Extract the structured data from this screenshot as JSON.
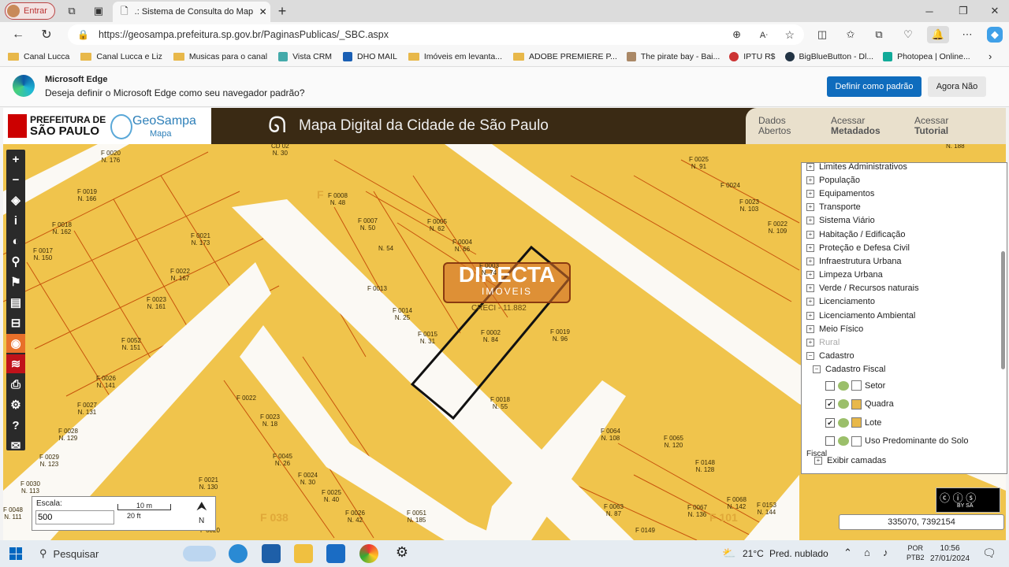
{
  "browser": {
    "profile_label": "Entrar",
    "tab_title": ".: Sistema de Consulta do Mapa D",
    "url": "https://geosampa.prefeitura.sp.gov.br/PaginasPublicas/_SBC.aspx",
    "bookmarks": [
      "Canal Lucca",
      "Canal Lucca e Liz",
      "Musicas para o canal",
      "Vista CRM",
      "DHO MAIL",
      "Imóveis em levanta...",
      "ADOBE PREMIERE P...",
      "The pirate bay - Bai...",
      "IPTU R$",
      "BigBlueButton - Dl...",
      "Photopea | Online..."
    ],
    "edge_prompt": {
      "title": "Microsoft Edge",
      "text": "Deseja definir o Microsoft Edge como seu navegador padrão?",
      "primary": "Definir como padrão",
      "secondary": "Agora Não"
    }
  },
  "site": {
    "prefeitura_line1": "PREFEITURA DE",
    "prefeitura_line2": "SÃO PAULO",
    "geosampa": "GeoSampa",
    "geosampa_sub": "Mapa",
    "title": "Mapa Digital da Cidade de São Paulo",
    "links": [
      [
        "Dados",
        "Abertos"
      ],
      [
        "Acessar",
        "Metadados"
      ],
      [
        "Acessar",
        "Tutorial"
      ]
    ]
  },
  "map": {
    "watermark": "DIRECTA",
    "watermark_sub": "IMOVEIS",
    "creci": "CRECI - 11.882",
    "labels": [
      [
        "F 0026",
        "N. 81"
      ],
      [
        "F 0020",
        "N. 176"
      ],
      [
        "CD 02",
        "N. 30"
      ],
      [
        "F 0019",
        "N. 166"
      ],
      [
        "F 0008",
        "N. 48"
      ],
      [
        "F 0018",
        "N. 162"
      ],
      [
        "F 0021",
        "N. 173"
      ],
      [
        "F 0007",
        "N. 50"
      ],
      [
        "F 0005",
        "N. 62"
      ],
      [
        "F 0004",
        "N. 66"
      ],
      [
        "F 0017",
        "N. 150"
      ],
      [
        "N. 54",
        ""
      ],
      [
        "F 0003",
        "N. 74"
      ],
      [
        "F 0022",
        "N. 167"
      ],
      [
        "F 0013",
        ""
      ],
      [
        "F 0023",
        "N. 161"
      ],
      [
        "F 0014",
        "N. 25"
      ],
      [
        "F 0015",
        "N. 31"
      ],
      [
        "F 0002",
        "N. 84"
      ],
      [
        "F 0019",
        "N. 96"
      ],
      [
        "F 0052",
        "N. 151"
      ],
      [
        "F 0026",
        "N. 141"
      ],
      [
        "F 0027",
        "N. 131"
      ],
      [
        "F 0028",
        "N. 129"
      ],
      [
        "F 0029",
        "N. 123"
      ],
      [
        "F 0022",
        ""
      ],
      [
        "F 0023",
        "N. 18"
      ],
      [
        "F 0045",
        "N. 26"
      ],
      [
        "F 0024",
        "N. 30"
      ],
      [
        "F 0025",
        "N. 40"
      ],
      [
        "F 0026",
        "N. 42"
      ],
      [
        "F 0051",
        "N. 185"
      ],
      [
        "F 0021",
        "N. 130"
      ],
      [
        "F 0030",
        "N. 113"
      ],
      [
        "F 0018",
        "N. 55"
      ],
      [
        "F 0064",
        "N. 108"
      ],
      [
        "F 0065",
        "N. 120"
      ],
      [
        "F 0148",
        "N. 128"
      ],
      [
        "F 0063",
        "N. 87"
      ],
      [
        "F 0067",
        "N. 136"
      ],
      [
        "F 0068",
        "N. 142"
      ],
      [
        "F 0153",
        "N. 144"
      ],
      [
        "F 0149",
        ""
      ],
      [
        "F 0025",
        "N. 91"
      ],
      [
        "F 0024",
        ""
      ],
      [
        "F 0023",
        "N. 103"
      ],
      [
        "F 0022",
        "N. 109"
      ],
      [
        "N. 188",
        ""
      ],
      [
        "F 0048",
        "N. 111"
      ],
      [
        "F 0020",
        ""
      ]
    ],
    "big_labels": [
      "F 038",
      "F 101",
      "F"
    ]
  },
  "layers": {
    "items": [
      "Limites Administrativos",
      "População",
      "Equipamentos",
      "Transporte",
      "Sistema Viário",
      "Habitação / Edificação",
      "Proteção e Defesa Civil",
      "Infraestrutura Urbana",
      "Limpeza Urbana",
      "Verde / Recursos naturais",
      "Licenciamento",
      "Licenciamento Ambiental",
      "Meio Físico",
      "Rural",
      "Cadastro"
    ],
    "sub": "Cadastro Fiscal",
    "checks": [
      {
        "label": "Setor",
        "checked": false
      },
      {
        "label": "Quadra",
        "checked": true
      },
      {
        "label": "Lote",
        "checked": true
      },
      {
        "label": "Uso Predominante do Solo",
        "checked": false
      }
    ],
    "fiscal": "Fiscal",
    "exibir": "Exibir camadas"
  },
  "scale": {
    "label": "Escala:",
    "value": "500",
    "bar_top": "10 m",
    "bar_bottom": "20 ft",
    "north": "N"
  },
  "coords": "335070, 7392154",
  "license": "BY SA",
  "taskbar": {
    "search": "Pesquisar",
    "weather_temp": "21°C",
    "weather_text": "Pred. nublado",
    "lang1": "POR",
    "lang2": "PTB2",
    "time": "10:56",
    "date": "27/01/2024"
  }
}
